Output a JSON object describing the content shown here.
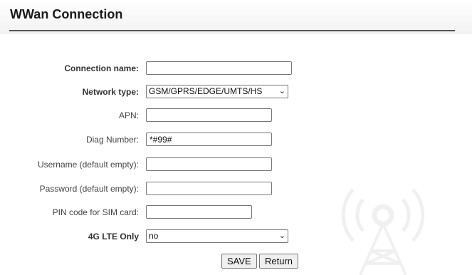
{
  "page": {
    "title": "WWan Connection"
  },
  "form": {
    "connection_name": {
      "label": "Connection name:",
      "value": ""
    },
    "network_type": {
      "label": "Network type:",
      "selected": "GSM/GPRS/EDGE/UMTS/HS"
    },
    "apn": {
      "label": "APN:",
      "value": ""
    },
    "diag_number": {
      "label": "Diag Number:",
      "value": "*#99#"
    },
    "username": {
      "label": "Username (default empty):",
      "value": ""
    },
    "password": {
      "label": "Password (default empty):",
      "value": ""
    },
    "pin_code": {
      "label": "PIN code for SIM card:",
      "value": ""
    },
    "lte_only": {
      "label": "4G LTE Only",
      "selected": "no"
    }
  },
  "buttons": {
    "save": "SAVE",
    "return": "Return"
  },
  "icons": {
    "dropdown": "chevron-down-icon",
    "watermark": "radio-tower-icon"
  }
}
